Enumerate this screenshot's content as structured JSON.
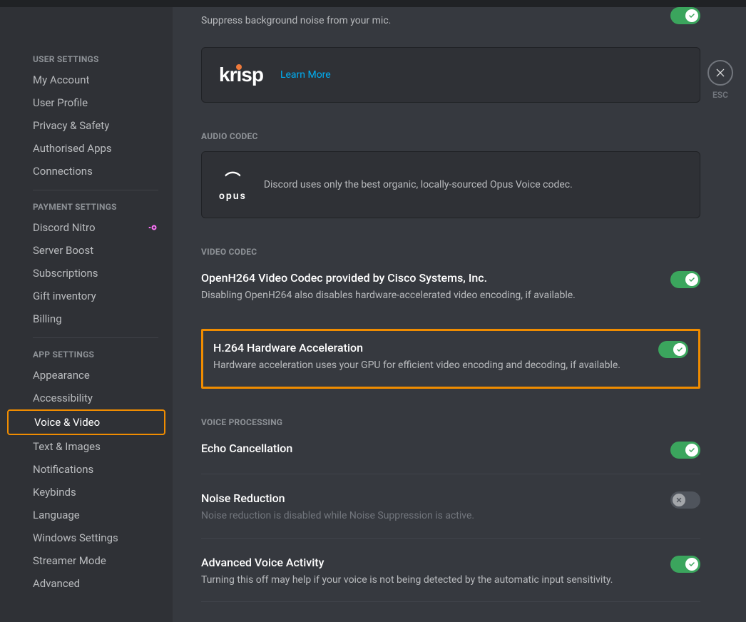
{
  "close_label": "ESC",
  "sidebar": {
    "sections": [
      {
        "header": "USER SETTINGS",
        "items": [
          "My Account",
          "User Profile",
          "Privacy & Safety",
          "Authorised Apps",
          "Connections"
        ]
      },
      {
        "header": "PAYMENT SETTINGS",
        "items": [
          "Discord Nitro",
          "Server Boost",
          "Subscriptions",
          "Gift inventory",
          "Billing"
        ]
      },
      {
        "header": "APP SETTINGS",
        "items": [
          "Appearance",
          "Accessibility",
          "Voice & Video",
          "Text & Images",
          "Notifications",
          "Keybinds",
          "Language",
          "Windows Settings",
          "Streamer Mode",
          "Advanced"
        ]
      }
    ],
    "active_item": "Voice & Video"
  },
  "top_desc": "Suppress background noise from your mic.",
  "krisp_link": "Learn More",
  "audio_codec": {
    "header": "AUDIO CODEC",
    "text": "Discord uses only the best organic, locally-sourced Opus Voice codec."
  },
  "video_codec": {
    "header": "VIDEO CODEC",
    "openh264": {
      "title": "OpenH264 Video Codec provided by Cisco Systems, Inc.",
      "desc": "Disabling OpenH264 also disables hardware-accelerated video encoding, if available.",
      "enabled": true
    },
    "hwaccel": {
      "title": "H.264 Hardware Acceleration",
      "desc": "Hardware acceleration uses your GPU for efficient video encoding and decoding, if available.",
      "enabled": true
    }
  },
  "voice_processing": {
    "header": "VOICE PROCESSING",
    "echo": {
      "title": "Echo Cancellation",
      "enabled": true
    },
    "noise": {
      "title": "Noise Reduction",
      "desc": "Noise reduction is disabled while Noise Suppression is active.",
      "enabled": false
    },
    "ava": {
      "title": "Advanced Voice Activity",
      "desc": "Turning this off may help if your voice is not being detected by the automatic input sensitivity.",
      "enabled": true
    }
  }
}
